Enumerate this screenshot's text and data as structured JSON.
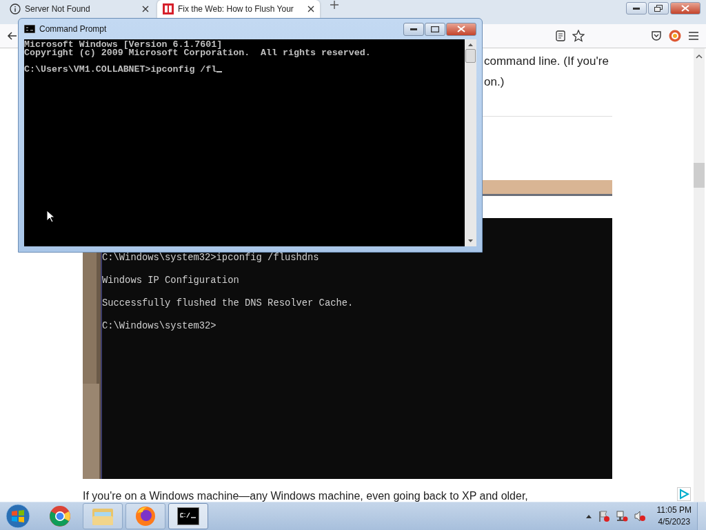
{
  "browser": {
    "tabs": [
      {
        "title": "Server Not Found",
        "selected": false
      },
      {
        "title": "Fix the Web: How to Flush Your",
        "selected": true
      }
    ],
    "article": {
      "lines": [
        "command line. (If you're",
        "on.)"
      ],
      "screenshot_lines": [
        "C:\\Windows\\system32>ipconfig /flushdns",
        "Windows IP Configuration",
        "Successfully flushed the DNS Resolver Cache.",
        "C:\\Windows\\system32>"
      ],
      "footer_text": "If you're on a Windows machine—any Windows machine, even going back to XP and older,"
    }
  },
  "console": {
    "title": "Command Prompt",
    "banner": [
      "Microsoft Windows [Version 6.1.7601]",
      "Copyright (c) 2009 Microsoft Corporation.  All rights reserved."
    ],
    "prompt": "C:\\Users\\VM1.COLLABNET>ipconfig /fl"
  },
  "taskbar": {
    "apps": [
      {
        "kind": "chrome",
        "running": false,
        "selected": false
      },
      {
        "kind": "explorer",
        "running": true,
        "selected": false
      },
      {
        "kind": "firefox",
        "running": true,
        "selected": false
      },
      {
        "kind": "terminal",
        "running": true,
        "selected": true
      }
    ],
    "time": "11:05 PM",
    "date": "4/5/2023"
  }
}
